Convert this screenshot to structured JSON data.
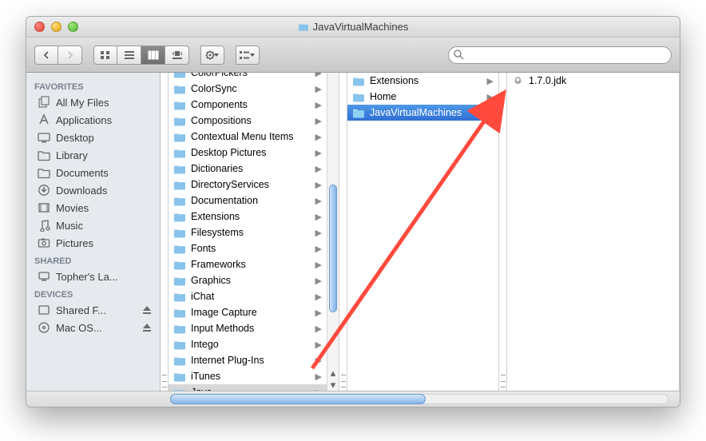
{
  "window": {
    "title": "JavaVirtualMachines"
  },
  "search": {
    "placeholder": ""
  },
  "sidebar": {
    "sections": [
      {
        "heading": "FAVORITES",
        "items": [
          {
            "icon": "allfiles",
            "label": "All My Files"
          },
          {
            "icon": "apps",
            "label": "Applications"
          },
          {
            "icon": "desktop",
            "label": "Desktop"
          },
          {
            "icon": "folder",
            "label": "Library"
          },
          {
            "icon": "folder",
            "label": "Documents"
          },
          {
            "icon": "download",
            "label": "Downloads"
          },
          {
            "icon": "movies",
            "label": "Movies"
          },
          {
            "icon": "music",
            "label": "Music"
          },
          {
            "icon": "pictures",
            "label": "Pictures"
          }
        ]
      },
      {
        "heading": "SHARED",
        "items": [
          {
            "icon": "computer",
            "label": "Topher's La..."
          }
        ]
      },
      {
        "heading": "DEVICES",
        "items": [
          {
            "icon": "drive",
            "label": "Shared F...",
            "eject": true
          },
          {
            "icon": "disc",
            "label": "Mac OS...",
            "eject": true
          }
        ]
      }
    ]
  },
  "columns": {
    "col1": {
      "scrollTopItemCut": "ColorPickers",
      "items": [
        "ColorPickers",
        "ColorSync",
        "Components",
        "Compositions",
        "Contextual Menu Items",
        "Desktop Pictures",
        "Dictionaries",
        "DirectoryServices",
        "Documentation",
        "Extensions",
        "Filesystems",
        "Fonts",
        "Frameworks",
        "Graphics",
        "iChat",
        "Image Capture",
        "Input Methods",
        "Intego",
        "Internet Plug-Ins",
        "iTunes",
        "Java"
      ],
      "selected": "Java"
    },
    "col2": {
      "items": [
        "Extensions",
        "Home",
        "JavaVirtualMachines"
      ],
      "selected": "JavaVirtualMachines"
    },
    "col3": {
      "items": [
        {
          "label": "1.7.0.jdk",
          "type": "package"
        }
      ]
    }
  }
}
